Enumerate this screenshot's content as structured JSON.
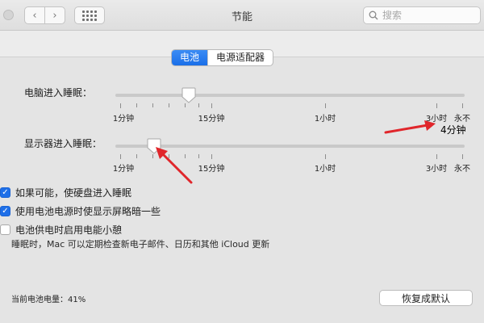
{
  "window": {
    "title": "节能"
  },
  "search": {
    "placeholder": "搜索"
  },
  "tabs": [
    {
      "label": "电池",
      "active": true
    },
    {
      "label": "电源适配器",
      "active": false
    }
  ],
  "computer_sleep": {
    "label": "电脑进入睡眠：",
    "ticks": [
      "1分钟",
      "15分钟",
      "1小时",
      "3小时",
      "永不"
    ]
  },
  "display_sleep": {
    "label": "显示器进入睡眠：",
    "value_text": "4分钟",
    "ticks": [
      "1分钟",
      "15分钟",
      "1小时",
      "3小时",
      "永不"
    ]
  },
  "options": [
    {
      "label": "如果可能，使硬盘进入睡眠",
      "checked": true
    },
    {
      "label": "使用电池电源时使显示屏略暗一些",
      "checked": true
    },
    {
      "label": "电池供电时启用电能小憩",
      "checked": false
    }
  ],
  "power_nap_note": "睡眠时，Mac 可以定期检查新电子邮件、日历和其他 iCloud 更新",
  "battery_status": "当前电池电量：41%",
  "reset_button": "恢复成默认",
  "colors": {
    "accent": "#1a6fe8",
    "arrow": "#e0262b"
  }
}
